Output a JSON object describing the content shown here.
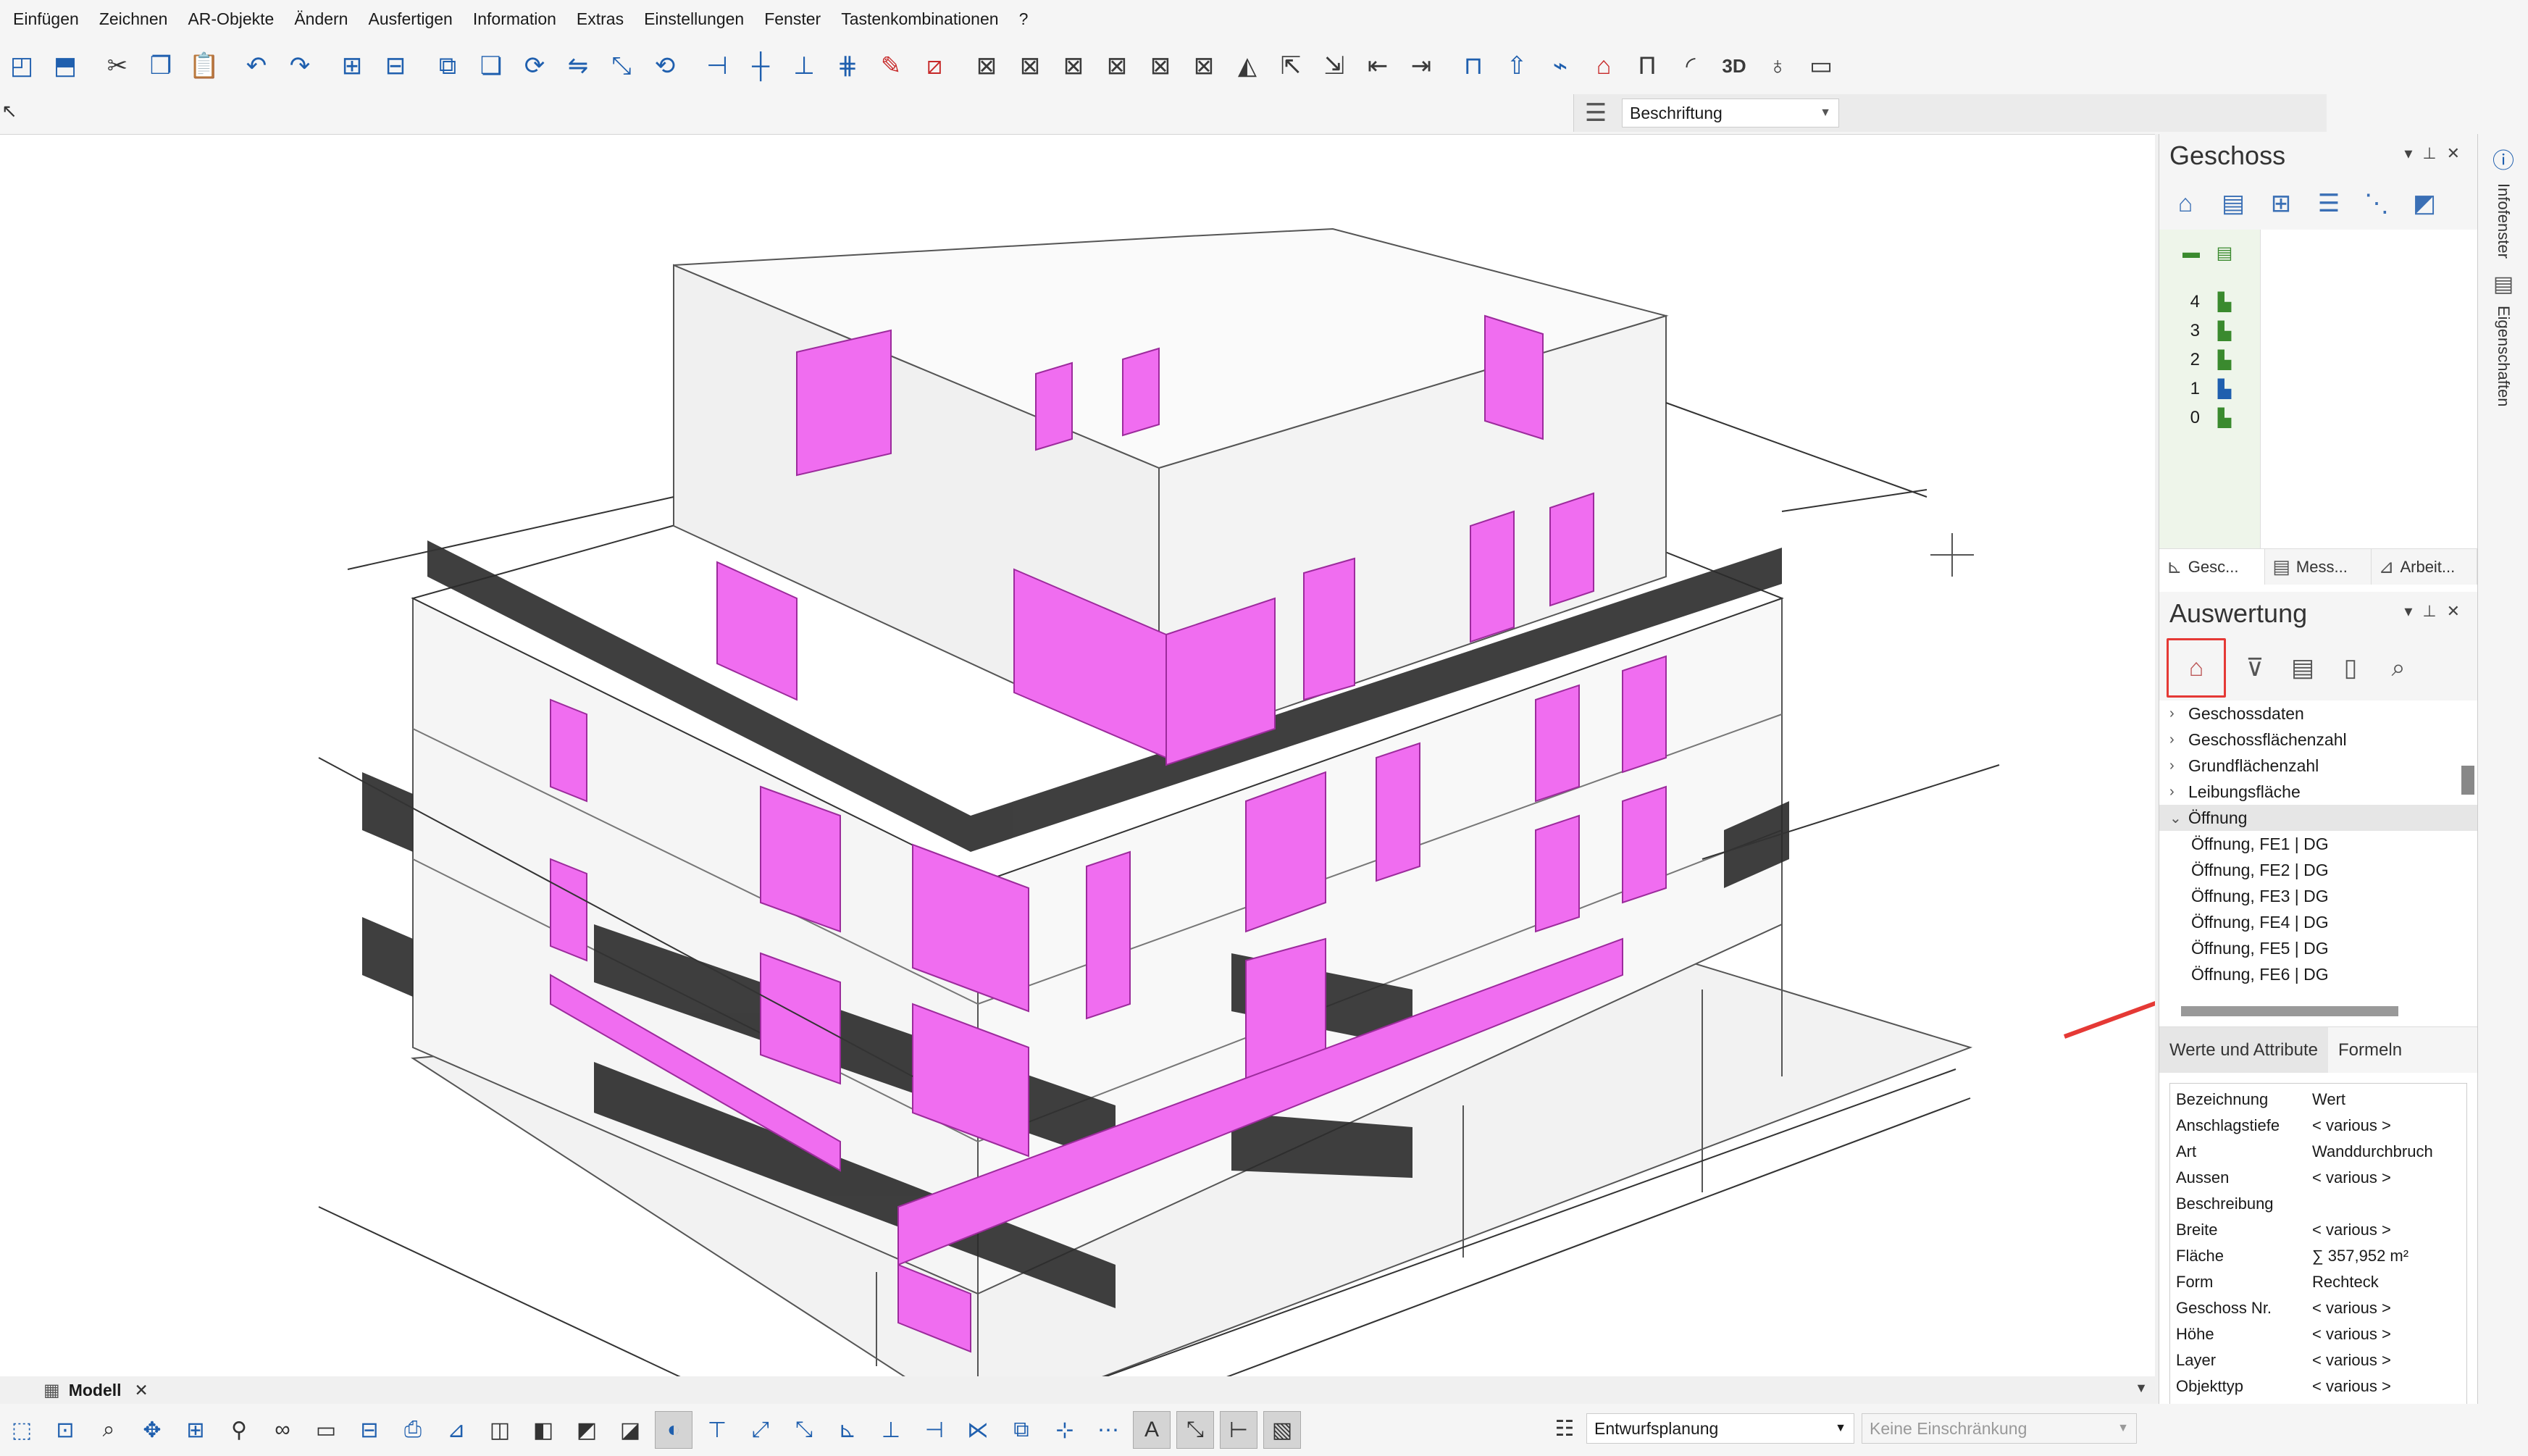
{
  "menu": [
    "Einfügen",
    "Zeichnen",
    "AR-Objekte",
    "Ändern",
    "Ausfertigen",
    "Information",
    "Extras",
    "Einstellungen",
    "Fenster",
    "Tastenkombinationen",
    "?"
  ],
  "toolbar": {
    "icons": [
      "new-icon",
      "save-icon",
      "cut-icon",
      "copy-icon",
      "paste-icon",
      "undo-icon",
      "redo-icon",
      "zoom-in-icon",
      "zoom-out-icon",
      "copy-element-icon",
      "duplicate-icon",
      "rotate-icon",
      "mirror-icon",
      "scale-icon",
      "cube-rotate-icon",
      "trim-icon",
      "extend-icon",
      "split-icon",
      "divide-icon",
      "erase-icon",
      "modify-icon",
      "wall-icon",
      "wall-b-icon",
      "wall-c-icon",
      "wall-d-icon",
      "wall-e-icon",
      "wall-f-icon",
      "pyramid-icon",
      "dimension-icon",
      "arrange-icon",
      "section-icon",
      "transfer-icon",
      "window-icon",
      "roof-icon",
      "ceiling-icon",
      "stair-icon",
      "3d-view-icon",
      "lamp-icon",
      "camera-icon"
    ],
    "layer_label": "Beschriftung"
  },
  "geschoss": {
    "title": "Geschoss",
    "levels": [
      "4",
      "3",
      "2",
      "1",
      "0"
    ],
    "tabs": [
      "Gesc...",
      "Mess...",
      "Arbeit..."
    ]
  },
  "auswertung": {
    "title": "Auswertung",
    "tree": [
      {
        "label": "Geschossdaten",
        "expanded": false
      },
      {
        "label": "Geschossflächenzahl",
        "expanded": false
      },
      {
        "label": "Grundflächenzahl",
        "expanded": false
      },
      {
        "label": "Leibungsfläche",
        "expanded": false
      },
      {
        "label": "Öffnung",
        "expanded": true
      }
    ],
    "children": [
      "Öffnung, FE1 | DG",
      "Öffnung, FE2 | DG",
      "Öffnung, FE3 | DG",
      "Öffnung, FE4 | DG",
      "Öffnung, FE5 | DG",
      "Öffnung, FE6 | DG"
    ],
    "tabs": [
      "Werte und Attribute",
      "Formeln"
    ],
    "attributes": [
      {
        "k": "Bezeichnung",
        "v": "Wert"
      },
      {
        "k": "Anschlagstiefe",
        "v": "< various >"
      },
      {
        "k": "Art",
        "v": "Wanddurchbruch"
      },
      {
        "k": "Aussen",
        "v": "< various >"
      },
      {
        "k": "Beschreibung",
        "v": ""
      },
      {
        "k": "Breite",
        "v": "< various >"
      },
      {
        "k": "Fläche",
        "v": "∑ 357,952 m²"
      },
      {
        "k": "Form",
        "v": "Rechteck"
      },
      {
        "k": "Geschoss Nr.",
        "v": "< various >"
      },
      {
        "k": "Höhe",
        "v": "< various >"
      },
      {
        "k": "Layer",
        "v": "< various >"
      },
      {
        "k": "Objekttyp",
        "v": "< various >"
      }
    ]
  },
  "side": [
    "Infofenster",
    "Eigenschaften"
  ],
  "model_tab": "Modell",
  "bottom": {
    "plan": "Entwurfsplanung",
    "restriction": "Keine Einschränkung"
  },
  "colors": {
    "opening_fill": "#f06df0",
    "highlight_box": "#e53935",
    "arrow": "#e53935"
  }
}
